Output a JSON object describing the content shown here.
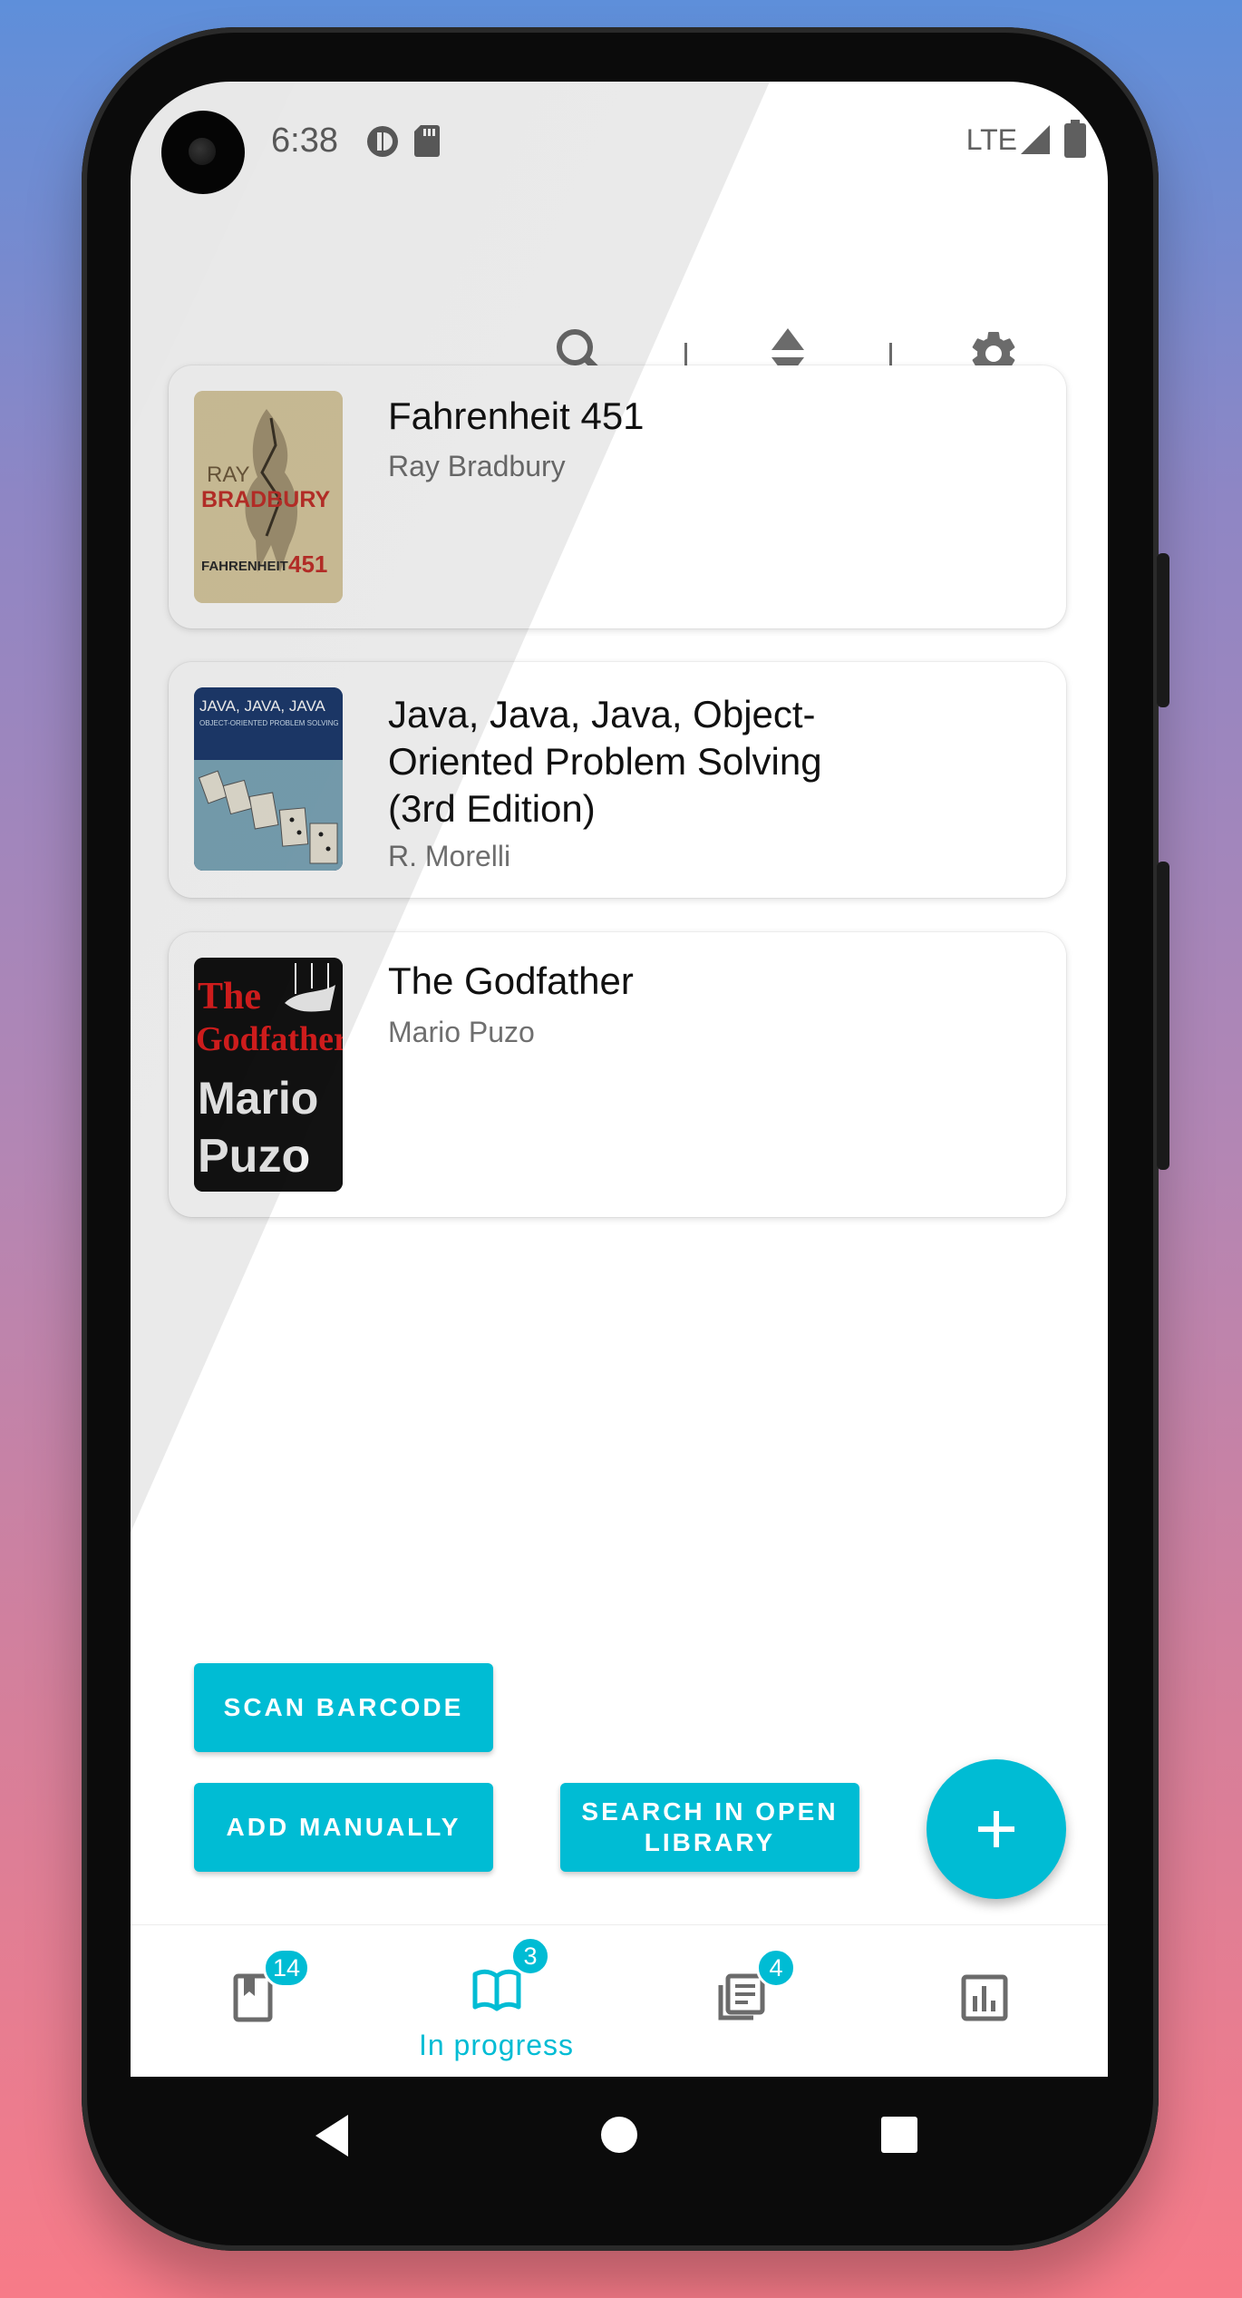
{
  "status_bar": {
    "time": "6:38",
    "network": "LTE"
  },
  "toolbar": {
    "icons": [
      "search-icon",
      "sort-icon",
      "settings-icon"
    ]
  },
  "books": [
    {
      "title": "Fahrenheit 451",
      "author": "Ray Bradbury",
      "cover": {
        "line1": "RAY",
        "line2": "BRADBURY",
        "line3": "FAHRENHEIT",
        "line4": "451"
      }
    },
    {
      "title": "Java, Java, Java, Object-Oriented Problem Solving (3rd Edition)",
      "author": "R. Morelli",
      "cover": {
        "line1": "JAVA, JAVA, JAVA",
        "line2": "OBJECT-ORIENTED PROBLEM SOLVING"
      }
    },
    {
      "title": "The Godfather",
      "author": "Mario Puzo",
      "cover": {
        "line1": "The",
        "line2": "Godfather",
        "line3": "Mario",
        "line4": "Puzo"
      }
    }
  ],
  "actions": {
    "scan_barcode": "SCAN BARCODE",
    "add_manually": "ADD MANUALLY",
    "search_open_library": "SEARCH IN OPEN LIBRARY",
    "fab_icon": "plus-icon"
  },
  "bottom_nav": [
    {
      "icon": "bookmark-icon",
      "badge": "14",
      "label": ""
    },
    {
      "icon": "open-book-icon",
      "badge": "3",
      "label": "In progress",
      "active": true
    },
    {
      "icon": "library-icon",
      "badge": "4",
      "label": ""
    },
    {
      "icon": "statistics-icon",
      "badge": "",
      "label": ""
    }
  ],
  "colors": {
    "accent": "#00bcd4",
    "icon_gray": "#6b6b6b"
  }
}
